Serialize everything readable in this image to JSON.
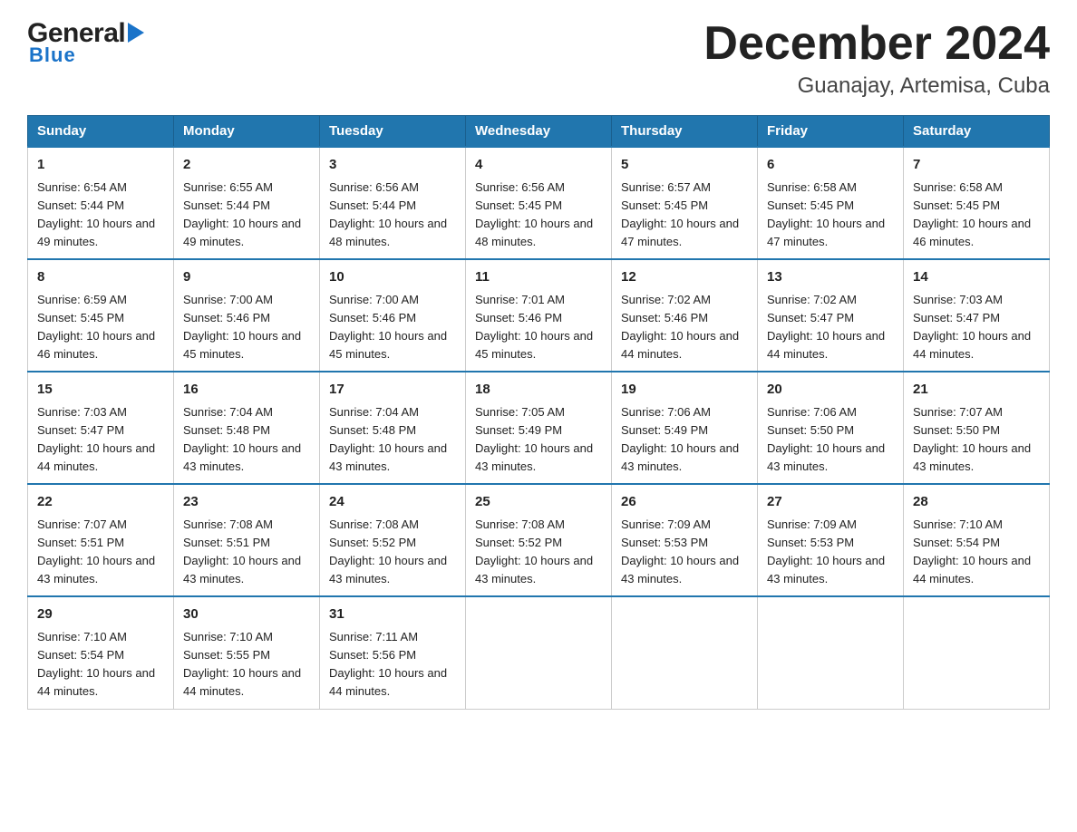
{
  "header": {
    "logo_general": "General",
    "logo_blue": "Blue",
    "title": "December 2024",
    "subtitle": "Guanajay, Artemisa, Cuba"
  },
  "days_of_week": [
    "Sunday",
    "Monday",
    "Tuesday",
    "Wednesday",
    "Thursday",
    "Friday",
    "Saturday"
  ],
  "weeks": [
    [
      {
        "day": "1",
        "sunrise": "6:54 AM",
        "sunset": "5:44 PM",
        "daylight": "10 hours and 49 minutes."
      },
      {
        "day": "2",
        "sunrise": "6:55 AM",
        "sunset": "5:44 PM",
        "daylight": "10 hours and 49 minutes."
      },
      {
        "day": "3",
        "sunrise": "6:56 AM",
        "sunset": "5:44 PM",
        "daylight": "10 hours and 48 minutes."
      },
      {
        "day": "4",
        "sunrise": "6:56 AM",
        "sunset": "5:45 PM",
        "daylight": "10 hours and 48 minutes."
      },
      {
        "day": "5",
        "sunrise": "6:57 AM",
        "sunset": "5:45 PM",
        "daylight": "10 hours and 47 minutes."
      },
      {
        "day": "6",
        "sunrise": "6:58 AM",
        "sunset": "5:45 PM",
        "daylight": "10 hours and 47 minutes."
      },
      {
        "day": "7",
        "sunrise": "6:58 AM",
        "sunset": "5:45 PM",
        "daylight": "10 hours and 46 minutes."
      }
    ],
    [
      {
        "day": "8",
        "sunrise": "6:59 AM",
        "sunset": "5:45 PM",
        "daylight": "10 hours and 46 minutes."
      },
      {
        "day": "9",
        "sunrise": "7:00 AM",
        "sunset": "5:46 PM",
        "daylight": "10 hours and 45 minutes."
      },
      {
        "day": "10",
        "sunrise": "7:00 AM",
        "sunset": "5:46 PM",
        "daylight": "10 hours and 45 minutes."
      },
      {
        "day": "11",
        "sunrise": "7:01 AM",
        "sunset": "5:46 PM",
        "daylight": "10 hours and 45 minutes."
      },
      {
        "day": "12",
        "sunrise": "7:02 AM",
        "sunset": "5:46 PM",
        "daylight": "10 hours and 44 minutes."
      },
      {
        "day": "13",
        "sunrise": "7:02 AM",
        "sunset": "5:47 PM",
        "daylight": "10 hours and 44 minutes."
      },
      {
        "day": "14",
        "sunrise": "7:03 AM",
        "sunset": "5:47 PM",
        "daylight": "10 hours and 44 minutes."
      }
    ],
    [
      {
        "day": "15",
        "sunrise": "7:03 AM",
        "sunset": "5:47 PM",
        "daylight": "10 hours and 44 minutes."
      },
      {
        "day": "16",
        "sunrise": "7:04 AM",
        "sunset": "5:48 PM",
        "daylight": "10 hours and 43 minutes."
      },
      {
        "day": "17",
        "sunrise": "7:04 AM",
        "sunset": "5:48 PM",
        "daylight": "10 hours and 43 minutes."
      },
      {
        "day": "18",
        "sunrise": "7:05 AM",
        "sunset": "5:49 PM",
        "daylight": "10 hours and 43 minutes."
      },
      {
        "day": "19",
        "sunrise": "7:06 AM",
        "sunset": "5:49 PM",
        "daylight": "10 hours and 43 minutes."
      },
      {
        "day": "20",
        "sunrise": "7:06 AM",
        "sunset": "5:50 PM",
        "daylight": "10 hours and 43 minutes."
      },
      {
        "day": "21",
        "sunrise": "7:07 AM",
        "sunset": "5:50 PM",
        "daylight": "10 hours and 43 minutes."
      }
    ],
    [
      {
        "day": "22",
        "sunrise": "7:07 AM",
        "sunset": "5:51 PM",
        "daylight": "10 hours and 43 minutes."
      },
      {
        "day": "23",
        "sunrise": "7:08 AM",
        "sunset": "5:51 PM",
        "daylight": "10 hours and 43 minutes."
      },
      {
        "day": "24",
        "sunrise": "7:08 AM",
        "sunset": "5:52 PM",
        "daylight": "10 hours and 43 minutes."
      },
      {
        "day": "25",
        "sunrise": "7:08 AM",
        "sunset": "5:52 PM",
        "daylight": "10 hours and 43 minutes."
      },
      {
        "day": "26",
        "sunrise": "7:09 AM",
        "sunset": "5:53 PM",
        "daylight": "10 hours and 43 minutes."
      },
      {
        "day": "27",
        "sunrise": "7:09 AM",
        "sunset": "5:53 PM",
        "daylight": "10 hours and 43 minutes."
      },
      {
        "day": "28",
        "sunrise": "7:10 AM",
        "sunset": "5:54 PM",
        "daylight": "10 hours and 44 minutes."
      }
    ],
    [
      {
        "day": "29",
        "sunrise": "7:10 AM",
        "sunset": "5:54 PM",
        "daylight": "10 hours and 44 minutes."
      },
      {
        "day": "30",
        "sunrise": "7:10 AM",
        "sunset": "5:55 PM",
        "daylight": "10 hours and 44 minutes."
      },
      {
        "day": "31",
        "sunrise": "7:11 AM",
        "sunset": "5:56 PM",
        "daylight": "10 hours and 44 minutes."
      },
      null,
      null,
      null,
      null
    ]
  ],
  "labels": {
    "sunrise": "Sunrise:",
    "sunset": "Sunset:",
    "daylight": "Daylight:"
  }
}
